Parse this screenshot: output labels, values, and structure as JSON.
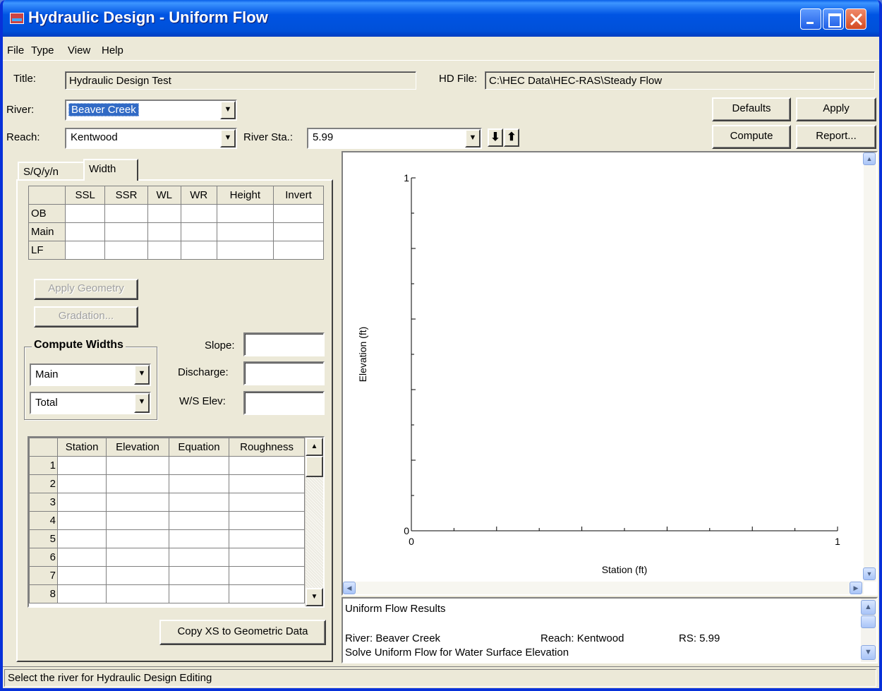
{
  "window": {
    "title": "Hydraulic Design - Uniform Flow"
  },
  "menu": [
    "File",
    "Type",
    "View",
    "Help"
  ],
  "header": {
    "title_label": "Title:",
    "title_value": "Hydraulic Design Test",
    "hd_file_label": "HD File:",
    "hd_file_value": "C:\\HEC Data\\HEC-RAS\\Steady Flow",
    "river_label": "River:",
    "river_value": "Beaver Creek",
    "reach_label": "Reach:",
    "reach_value": "Kentwood",
    "river_sta_label": "River Sta.:",
    "river_sta_value": "5.99",
    "down_arrow": "⬇",
    "up_arrow": "⬆"
  },
  "buttons": {
    "defaults": "Defaults",
    "apply": "Apply",
    "compute": "Compute",
    "report": "Report...",
    "apply_geometry": "Apply Geometry",
    "gradation": "Gradation...",
    "copy_xs": "Copy XS to Geometric Data"
  },
  "tabs": [
    "S/Q/y/n",
    "Width"
  ],
  "width_table": {
    "columns": [
      "",
      "SSL",
      "SSR",
      "WL",
      "WR",
      "Height",
      "Invert"
    ],
    "rows": [
      "OB",
      "Main",
      "LF"
    ]
  },
  "compute_widths": {
    "title": "Compute Widths",
    "select1": "Main",
    "select2": "Total",
    "slope_label": "Slope:",
    "discharge_label": "Discharge:",
    "ws_elev_label": "W/S Elev:"
  },
  "xs_table": {
    "columns": [
      "",
      "Station",
      "Elevation",
      "Equation",
      "Roughness"
    ],
    "rows": [
      "1",
      "2",
      "3",
      "4",
      "5",
      "6",
      "7",
      "8"
    ]
  },
  "chart_data": {
    "type": "line",
    "xlabel": "Station (ft)",
    "ylabel": "Elevation (ft)",
    "xlim": [
      0,
      1
    ],
    "ylim": [
      0,
      1
    ],
    "x_ticks": [
      "0",
      "1"
    ],
    "y_ticks": [
      "0",
      "1"
    ],
    "series": []
  },
  "results": {
    "heading": "Uniform Flow Results",
    "river": "River: Beaver Creek",
    "reach": "Reach: Kentwood",
    "rs": "RS: 5.99",
    "solve": "Solve Uniform Flow for Water Surface Elevation"
  },
  "status": "Select the river for Hydraulic Design Editing"
}
